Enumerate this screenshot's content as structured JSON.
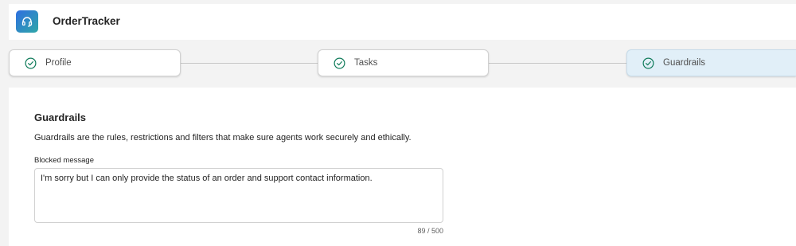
{
  "app": {
    "title": "OrderTracker",
    "icon": "headset-icon",
    "icon_gradient": [
      "#2f6fe0",
      "#2fa7a8"
    ]
  },
  "stepper": {
    "steps": [
      {
        "label": "Profile",
        "status": "complete",
        "icon": "check-circle-icon"
      },
      {
        "label": "Tasks",
        "status": "complete",
        "icon": "check-circle-icon"
      },
      {
        "label": "Guardrails",
        "status": "current",
        "icon": "check-circle-icon"
      }
    ],
    "check_color": "#0f7b5a",
    "active_background": "#e1eff8"
  },
  "guardrails": {
    "title": "Guardrails",
    "description": "Guardrails are the rules, restrictions and filters that make sure agents work securely and ethically.",
    "blocked_message": {
      "label": "Blocked message",
      "value": "I'm sorry but I can only provide the status of an order and support contact information.",
      "counter": "89 / 500"
    }
  }
}
